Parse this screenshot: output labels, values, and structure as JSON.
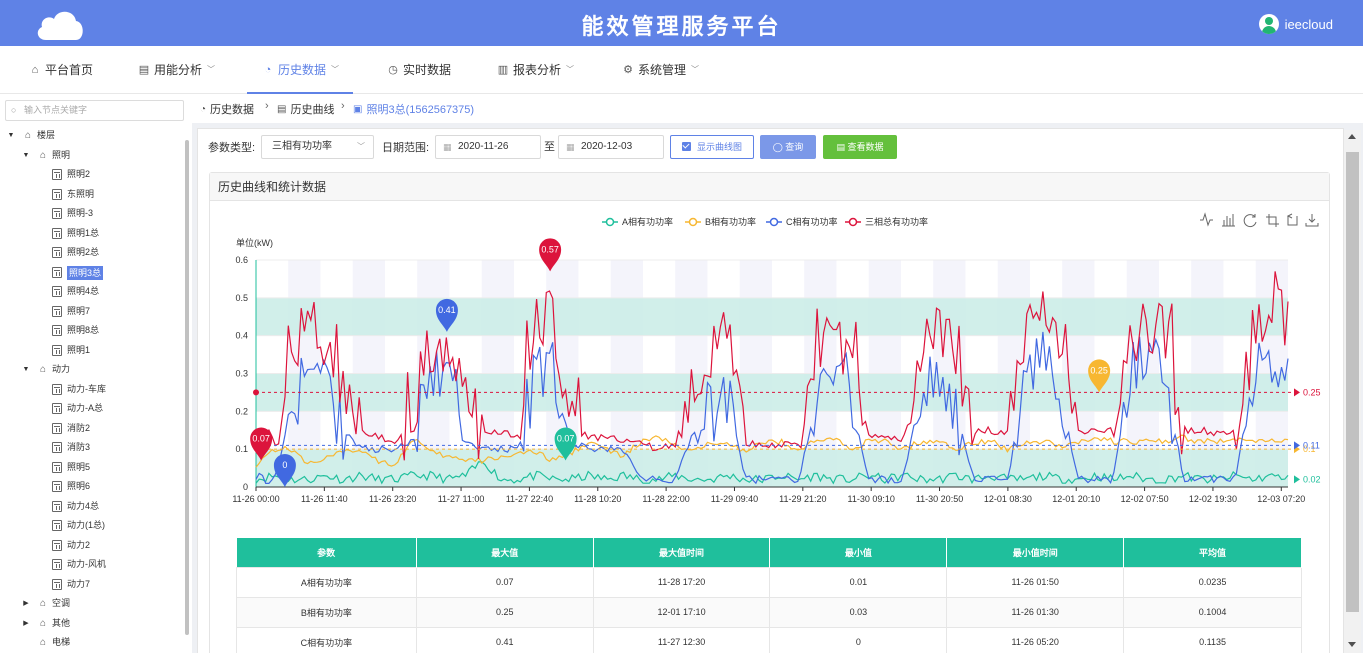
{
  "header": {
    "title": "能效管理服务平台",
    "user": "ieecloud"
  },
  "nav": [
    {
      "label": "平台首页",
      "icon": "home-icon"
    },
    {
      "label": "用能分析",
      "icon": "doc-icon"
    },
    {
      "label": "历史数据",
      "icon": "gauge-icon"
    },
    {
      "label": "实时数据",
      "icon": "clock-icon"
    },
    {
      "label": "报表分析",
      "icon": "bar-chart-icon"
    },
    {
      "label": "系统管理",
      "icon": "gear-icon"
    }
  ],
  "tree": {
    "search_placeholder": "输入节点关键字",
    "nodes": [
      {
        "label": "楼层",
        "level": 0,
        "toggle": "▼",
        "type": "home"
      },
      {
        "label": "照明",
        "level": 1,
        "toggle": "▼",
        "type": "home"
      },
      {
        "label": "照明2",
        "level": 2,
        "type": "meter"
      },
      {
        "label": "东照明",
        "level": 2,
        "type": "meter"
      },
      {
        "label": "照明-3",
        "level": 2,
        "type": "meter"
      },
      {
        "label": "照明1总",
        "level": 2,
        "type": "meter"
      },
      {
        "label": "照明2总",
        "level": 2,
        "type": "meter"
      },
      {
        "label": "照明3总",
        "level": 2,
        "type": "meter",
        "selected": true
      },
      {
        "label": "照明4总",
        "level": 2,
        "type": "meter"
      },
      {
        "label": "照明7",
        "level": 2,
        "type": "meter"
      },
      {
        "label": "照明8总",
        "level": 2,
        "type": "meter"
      },
      {
        "label": "照明1",
        "level": 2,
        "type": "meter"
      },
      {
        "label": "动力",
        "level": 1,
        "toggle": "▼",
        "type": "home"
      },
      {
        "label": "动力-车库",
        "level": 2,
        "type": "meter"
      },
      {
        "label": "动力-A总",
        "level": 2,
        "type": "meter"
      },
      {
        "label": "消防2",
        "level": 2,
        "type": "meter"
      },
      {
        "label": "消防3",
        "level": 2,
        "type": "meter"
      },
      {
        "label": "照明5",
        "level": 2,
        "type": "meter"
      },
      {
        "label": "照明6",
        "level": 2,
        "type": "meter"
      },
      {
        "label": "动力4总",
        "level": 2,
        "type": "meter"
      },
      {
        "label": "动力(1总)",
        "level": 2,
        "type": "meter"
      },
      {
        "label": "动力2",
        "level": 2,
        "type": "meter"
      },
      {
        "label": "动力-风机",
        "level": 2,
        "type": "meter"
      },
      {
        "label": "动力7",
        "level": 2,
        "type": "meter"
      },
      {
        "label": "空调",
        "level": 1,
        "toggle": "▶",
        "type": "home"
      },
      {
        "label": "其他",
        "level": 1,
        "toggle": "▶",
        "type": "home"
      },
      {
        "label": "电梯",
        "level": 1,
        "type": "home"
      }
    ]
  },
  "breadcrumb": [
    "历史数据",
    "历史曲线",
    "照明3总(1562567375)"
  ],
  "filters": {
    "param_label": "参数类型:",
    "param_value": "三相有功功率",
    "date_label": "日期范围:",
    "start_date": "2020-11-26",
    "sep": "至",
    "end_date": "2020-12-03",
    "show_curve_label": "显示曲线图",
    "query_label": "查询",
    "view_label": "查看数据"
  },
  "card_title": "历史曲线和统计数据",
  "chart_data": {
    "type": "line",
    "ylabel": "单位(kW)",
    "ylim": [
      0,
      0.6
    ],
    "yticks": [
      0,
      0.1,
      0.2,
      0.3,
      0.4,
      0.5,
      0.6
    ],
    "xticks": [
      "11-26 00:00",
      "11-26 11:40",
      "11-26 23:20",
      "11-27 11:00",
      "11-27 22:40",
      "11-28 10:20",
      "11-28 22:00",
      "11-29 09:40",
      "11-29 21:20",
      "11-30 09:10",
      "11-30 20:50",
      "12-01 08:30",
      "12-01 20:10",
      "12-02 07:50",
      "12-02 19:30",
      "12-03 07:20"
    ],
    "legend_position": "top-center",
    "toolbox": [
      "line-switch-icon",
      "bar-switch-icon",
      "restore-icon",
      "zoom-icon",
      "zoom-reset-icon",
      "download-icon"
    ],
    "series": [
      {
        "name": "A相有功功率",
        "color": "#1fbf9c",
        "max": 0.07,
        "min": 0.01,
        "avg": 0.02,
        "max_label_pos": 0.3,
        "profile": [
          0.02,
          0.03,
          0.02,
          0.02,
          0.03,
          0.02,
          0.03,
          0.02,
          0.02,
          0.03,
          0.03,
          0.02,
          0.03,
          0.07,
          0.02,
          0.02,
          0.03,
          0.02,
          0.02,
          0.03,
          0.02,
          0.03,
          0.02,
          0.02,
          0.03,
          0.02,
          0.02,
          0.03,
          0.02,
          0.02,
          0.03,
          0.02,
          0.03,
          0.02,
          0.02,
          0.03,
          0.02,
          0.03,
          0.02,
          0.02,
          0.03,
          0.02,
          0.03,
          0.02,
          0.02,
          0.03,
          0.02,
          0.02,
          0.03,
          0.02,
          0.03,
          0.02,
          0.02,
          0.03,
          0.02,
          0.02,
          0.03,
          0.02,
          0.03,
          0.02
        ]
      },
      {
        "name": "B相有功功率",
        "color": "#f7b731",
        "max": 0.25,
        "min": 0.03,
        "avg": 0.1,
        "max_label_pos": 0.817,
        "profile": [
          0.06,
          0.1,
          0.1,
          0.06,
          0.08,
          0.09,
          0.1,
          0.07,
          0.06,
          0.13,
          0.09,
          0.08,
          0.07,
          0.07,
          0.08,
          0.09,
          0.09,
          0.07,
          0.09,
          0.12,
          0.1,
          0.08,
          0.12,
          0.13,
          0.11,
          0.09,
          0.12,
          0.12,
          0.09,
          0.12,
          0.12,
          0.1,
          0.12,
          0.13,
          0.1,
          0.12,
          0.12,
          0.1,
          0.12,
          0.12,
          0.1,
          0.12,
          0.12,
          0.1,
          0.12,
          0.12,
          0.11,
          0.12,
          0.13,
          0.12,
          0.12,
          0.12,
          0.12,
          0.13,
          0.12,
          0.12,
          0.13,
          0.12,
          0.12,
          0.12
        ]
      },
      {
        "name": "C相有功功率",
        "color": "#4169e1",
        "max": 0.41,
        "min": 0,
        "avg": 0.11,
        "max_label_pos": 0.185,
        "min_label_pos": 0.028,
        "profile": [
          0.03,
          0.01,
          0.2,
          0.3,
          0.28,
          0.15,
          0.1,
          0.1,
          0.1,
          0.12,
          0.3,
          0.35,
          0.12,
          0.1,
          0.1,
          0.1,
          0.3,
          0.3,
          0.12,
          0.1,
          0.1,
          0.1,
          0.02,
          0.02,
          0.02,
          0.15,
          0.2,
          0.25,
          0.02,
          0.02,
          0.02,
          0.02,
          0.2,
          0.3,
          0.25,
          0.02,
          0.02,
          0.02,
          0.25,
          0.3,
          0.2,
          0.02,
          0.02,
          0.02,
          0.3,
          0.35,
          0.25,
          0.02,
          0.02,
          0.02,
          0.3,
          0.35,
          0.3,
          0.02,
          0.02,
          0.02,
          0.02,
          0.3,
          0.35,
          0.3
        ]
      },
      {
        "name": "三相总有功功率",
        "color": "#dc143c",
        "max": 0.57,
        "min": 0.07,
        "avg": 0.25,
        "max_label_pos": 0.285,
        "min_label_pos": 0.005,
        "profile": [
          0.15,
          0.14,
          0.35,
          0.42,
          0.4,
          0.25,
          0.15,
          0.13,
          0.12,
          0.2,
          0.38,
          0.4,
          0.2,
          0.15,
          0.14,
          0.14,
          0.42,
          0.44,
          0.2,
          0.13,
          0.13,
          0.12,
          0.12,
          0.1,
          0.11,
          0.3,
          0.35,
          0.38,
          0.12,
          0.11,
          0.11,
          0.12,
          0.38,
          0.42,
          0.35,
          0.14,
          0.13,
          0.13,
          0.35,
          0.42,
          0.36,
          0.15,
          0.15,
          0.14,
          0.4,
          0.45,
          0.38,
          0.15,
          0.15,
          0.15,
          0.4,
          0.45,
          0.4,
          0.15,
          0.15,
          0.14,
          0.14,
          0.4,
          0.45,
          0.42
        ]
      }
    ]
  },
  "table": {
    "headers": [
      "参数",
      "最大值",
      "最大值时间",
      "最小值",
      "最小值时间",
      "平均值"
    ],
    "rows": [
      [
        "A相有功功率",
        "0.07",
        "11-28 17:20",
        "0.01",
        "11-26 01:50",
        "0.0235"
      ],
      [
        "B相有功功率",
        "0.25",
        "12-01 17:10",
        "0.03",
        "11-26 01:30",
        "0.1004"
      ],
      [
        "C相有功功率",
        "0.41",
        "11-27 12:30",
        "0",
        "11-26 05:20",
        "0.1135"
      ]
    ]
  }
}
